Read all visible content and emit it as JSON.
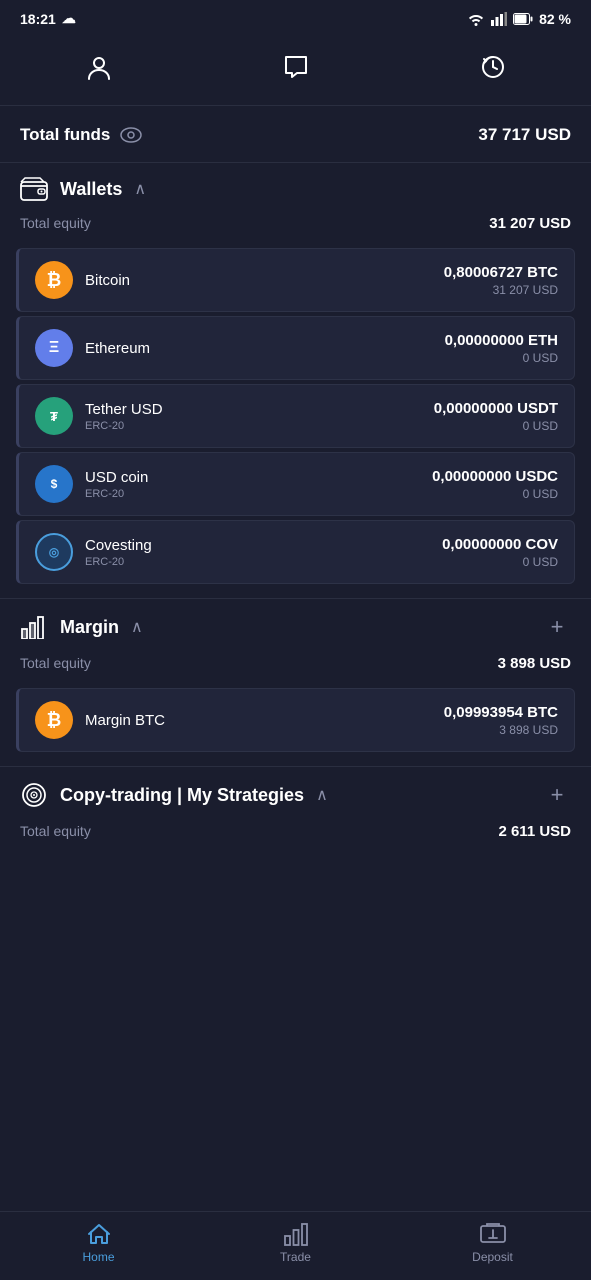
{
  "statusBar": {
    "time": "18:21",
    "battery": "82 %"
  },
  "nav": {
    "profileIcon": "👤",
    "chatIcon": "💬",
    "historyIcon": "⟳"
  },
  "totalFunds": {
    "label": "Total funds",
    "value": "37 717 USD"
  },
  "wallets": {
    "title": "Wallets",
    "equityLabel": "Total equity",
    "equityValue": "31 207 USD",
    "items": [
      {
        "name": "Bitcoin",
        "tag": "",
        "amount": "0,80006727 BTC",
        "usd": "31 207 USD",
        "iconType": "btc",
        "iconText": "₿"
      },
      {
        "name": "Ethereum",
        "tag": "",
        "amount": "0,00000000 ETH",
        "usd": "0 USD",
        "iconType": "eth",
        "iconText": "Ξ"
      },
      {
        "name": "Tether USD",
        "tag": "ERC-20",
        "amount": "0,00000000 USDT",
        "usd": "0 USD",
        "iconType": "usdt",
        "iconText": "₮"
      },
      {
        "name": "USD coin",
        "tag": "ERC-20",
        "amount": "0,00000000 USDC",
        "usd": "0 USD",
        "iconType": "usdc",
        "iconText": "$"
      },
      {
        "name": "Covesting",
        "tag": "ERC-20",
        "amount": "0,00000000 COV",
        "usd": "0 USD",
        "iconType": "cov",
        "iconText": "◎"
      }
    ]
  },
  "margin": {
    "title": "Margin",
    "equityLabel": "Total equity",
    "equityValue": "3 898 USD",
    "items": [
      {
        "name": "Margin BTC",
        "tag": "",
        "amount": "0,09993954 BTC",
        "usd": "3 898 USD",
        "iconType": "btc",
        "iconText": "₿"
      }
    ]
  },
  "copyTrading": {
    "title": "Copy-trading | My Strategies",
    "equityLabel": "Total equity",
    "equityValue": "2 611 USD"
  },
  "bottomNav": {
    "items": [
      {
        "label": "Home",
        "active": true
      },
      {
        "label": "Trade",
        "active": false
      },
      {
        "label": "Deposit",
        "active": false
      }
    ]
  }
}
